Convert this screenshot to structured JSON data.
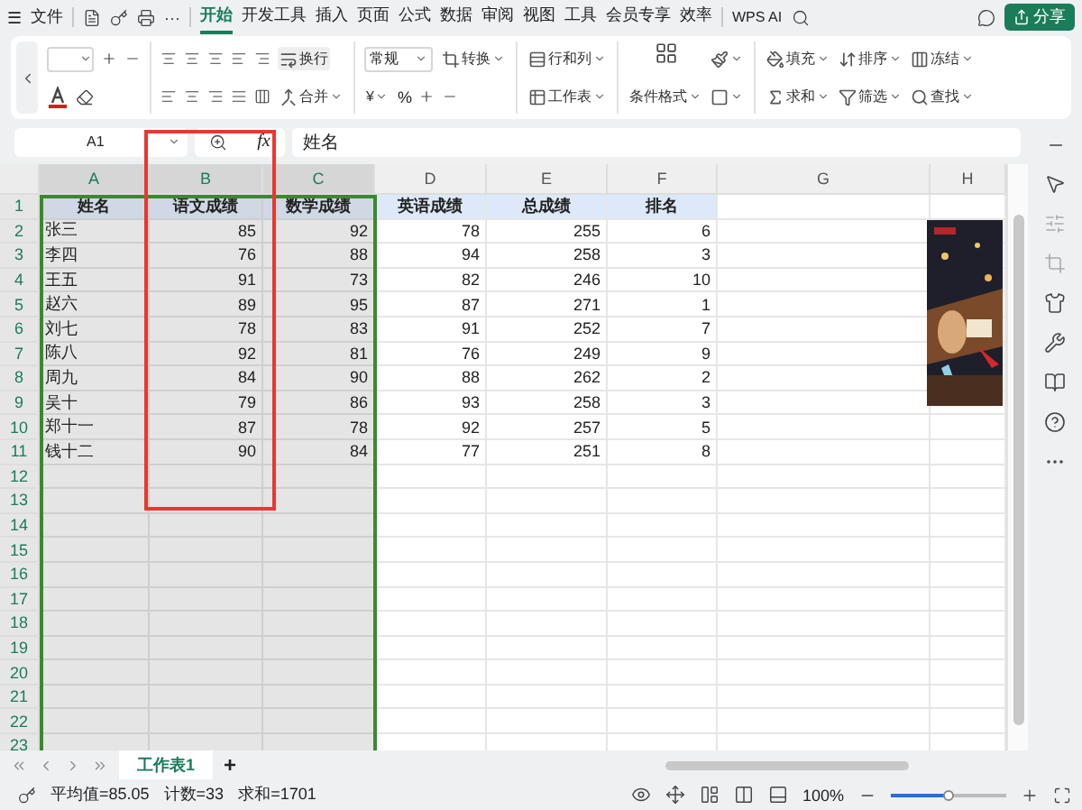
{
  "menu_bar": {
    "menu": "☰",
    "file": "文件",
    "more": "···",
    "tabs": [
      {
        "label": "开始",
        "selected": true
      },
      {
        "label": "开发工具",
        "selected": false
      },
      {
        "label": "插入",
        "selected": false
      },
      {
        "label": "页面",
        "selected": false
      },
      {
        "label": "公式",
        "selected": false
      },
      {
        "label": "数据",
        "selected": false
      },
      {
        "label": "审阅",
        "selected": false
      },
      {
        "label": "视图",
        "selected": false
      },
      {
        "label": "工具",
        "selected": false
      },
      {
        "label": "会员专享",
        "selected": false
      },
      {
        "label": "效率",
        "selected": false
      }
    ],
    "ai": "WPS AI",
    "share": "分享"
  },
  "ribbon": {
    "wrap": "换行",
    "merge": "合并",
    "number_format": "常规",
    "convert": "转换",
    "currency": "¥",
    "percent": "%",
    "rows_cols": "行和列",
    "worksheet": "工作表",
    "cond_format": "条件格式",
    "fill": "填充",
    "sort": "排序",
    "freeze": "冻结",
    "sum": "求和",
    "filter": "筛选",
    "find": "查找"
  },
  "formula_bar": {
    "cell": "A1",
    "fx": "fx",
    "content": "姓名"
  },
  "sheet": {
    "columns": [
      {
        "label": "A",
        "selected": true
      },
      {
        "label": "B",
        "selected": true
      },
      {
        "label": "C",
        "selected": true
      },
      {
        "label": "D",
        "selected": false
      },
      {
        "label": "E",
        "selected": false
      },
      {
        "label": "F",
        "selected": false
      },
      {
        "label": "G",
        "selected": false
      },
      {
        "label": "H",
        "selected": false
      }
    ],
    "rows": [
      {
        "number": "1",
        "kind": "header",
        "cells": [
          "姓名",
          "语文成绩",
          "数学成绩",
          "英语成绩",
          "总成绩",
          "排名"
        ]
      },
      {
        "number": "2",
        "kind": "data",
        "cells": [
          "张三",
          "85",
          "92",
          "78",
          "255",
          "6"
        ]
      },
      {
        "number": "3",
        "kind": "data",
        "cells": [
          "李四",
          "76",
          "88",
          "94",
          "258",
          "3"
        ]
      },
      {
        "number": "4",
        "kind": "data",
        "cells": [
          "王五",
          "91",
          "73",
          "82",
          "246",
          "10"
        ]
      },
      {
        "number": "5",
        "kind": "data",
        "cells": [
          "赵六",
          "89",
          "95",
          "87",
          "271",
          "1"
        ]
      },
      {
        "number": "6",
        "kind": "data",
        "cells": [
          "刘七",
          "78",
          "83",
          "91",
          "252",
          "7"
        ]
      },
      {
        "number": "7",
        "kind": "data",
        "cells": [
          "陈八",
          "92",
          "81",
          "76",
          "249",
          "9"
        ]
      },
      {
        "number": "8",
        "kind": "data",
        "cells": [
          "周九",
          "84",
          "90",
          "88",
          "262",
          "2"
        ]
      },
      {
        "number": "9",
        "kind": "data",
        "cells": [
          "吴十",
          "79",
          "86",
          "93",
          "258",
          "3"
        ]
      },
      {
        "number": "10",
        "kind": "data",
        "cells": [
          "郑十一",
          "87",
          "78",
          "92",
          "257",
          "5"
        ]
      },
      {
        "number": "11",
        "kind": "data",
        "cells": [
          "钱十二",
          "90",
          "84",
          "77",
          "251",
          "8"
        ]
      },
      {
        "number": "12",
        "kind": "empty"
      },
      {
        "number": "13",
        "kind": "empty"
      },
      {
        "number": "14",
        "kind": "empty"
      },
      {
        "number": "15",
        "kind": "empty"
      },
      {
        "number": "16",
        "kind": "empty"
      },
      {
        "number": "17",
        "kind": "empty"
      },
      {
        "number": "18",
        "kind": "empty"
      },
      {
        "number": "19",
        "kind": "empty"
      },
      {
        "number": "20",
        "kind": "empty"
      },
      {
        "number": "21",
        "kind": "empty"
      },
      {
        "number": "22",
        "kind": "empty"
      },
      {
        "number": "23",
        "kind": "empty"
      }
    ]
  },
  "sheet_tabs": [
    {
      "label": "工作表1",
      "selected": true
    }
  ],
  "add_sheet": "+",
  "status_bar": {
    "average": "平均值=85.05",
    "count": "计数=33",
    "sum": "求和=1701",
    "zoom": "100%",
    "zoom_slider": {
      "level": 0.5
    }
  }
}
